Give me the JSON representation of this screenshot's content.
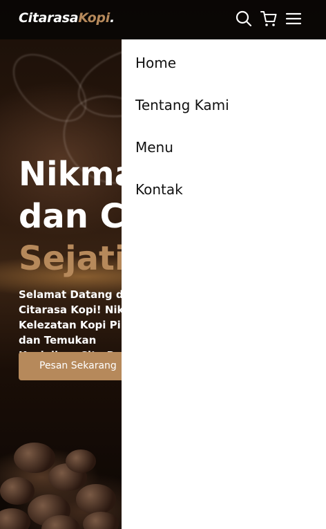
{
  "navbar": {
    "brand": {
      "part1": "Citarasa",
      "part2": "Kopi",
      "part3": "."
    },
    "icons": [
      "search-icon",
      "cart-icon",
      "hamburger-menu-icon"
    ]
  },
  "hero": {
    "title_line1": "Nikmati",
    "title_line2": "dan Cita",
    "title_line3": "Sejati",
    "description": "Selamat Datang di Citarasa Kopi! Nikmati Kelezatan Kopi Pilihan dan Temukan Keajaiban Cita Rasa Bersama Kami!",
    "cta_label": "Pesan Sekarang"
  },
  "side_menu": {
    "items": [
      {
        "label": "Home"
      },
      {
        "label": "Tentang Kami"
      },
      {
        "label": "Menu"
      },
      {
        "label": "Kontak"
      }
    ]
  },
  "colors": {
    "accent": "#b6895b",
    "navbar_bg": "#080605",
    "menu_bg": "#ffffff",
    "menu_text": "#111111"
  }
}
